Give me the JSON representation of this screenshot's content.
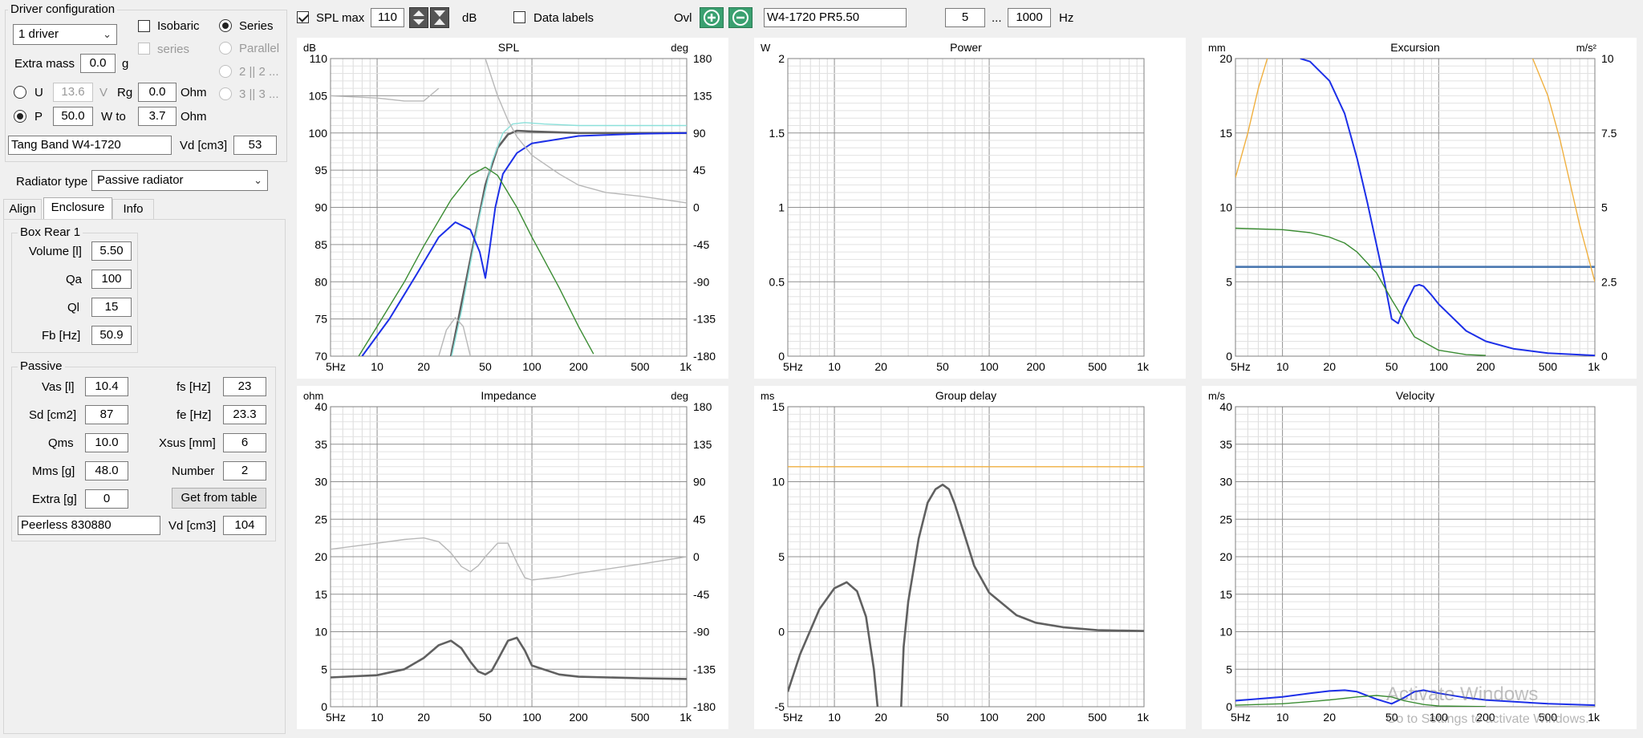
{
  "sidebar": {
    "driver_config_title": "Driver configuration",
    "driver_count": "1 driver",
    "isobaric": "Isobaric",
    "series": "Series",
    "series_sub": "series",
    "parallel": "Parallel",
    "par2": "2 || 2 ...",
    "par3": "3 || 3 ...",
    "extra_mass_label": "Extra mass",
    "extra_mass_value": "0.0",
    "extra_mass_unit": "g",
    "u_label": "U",
    "u_value": "13.6",
    "u_unit": "V",
    "rg_label": "Rg",
    "rg_value": "0.0",
    "rg_unit": "Ohm",
    "p_label": "P",
    "p_value": "50.0",
    "wto_label": "W to",
    "wto_value": "3.7",
    "wto_unit": "Ohm",
    "driver_name": "Tang Band W4-1720",
    "vd_label": "Vd [cm3]",
    "vd_value": "53",
    "radiator_type_label": "Radiator type",
    "radiator_type_value": "Passive radiator",
    "tabs": [
      "Align",
      "Enclosure",
      "Info"
    ],
    "box_title": "Box Rear 1",
    "volume_label": "Volume [l]",
    "volume_value": "5.50",
    "qa_label": "Qa",
    "qa_value": "100",
    "ql_label": "Ql",
    "ql_value": "15",
    "fb_label": "Fb [Hz]",
    "fb_value": "50.9",
    "passive_title": "Passive",
    "vas_label": "Vas [l]",
    "vas_value": "10.4",
    "fs_label": "fs [Hz]",
    "fs_value": "23",
    "sd_label": "Sd [cm2]",
    "sd_value": "87",
    "fe_label": "fe [Hz]",
    "fe_value": "23.3",
    "qms_label": "Qms",
    "qms_value": "10.0",
    "xsus_label": "Xsus [mm]",
    "xsus_value": "6",
    "mms_label": "Mms [g]",
    "mms_value": "48.0",
    "number_label": "Number",
    "number_value": "2",
    "extra_label": "Extra [g]",
    "extra_value": "0",
    "get_table": "Get from table",
    "pr_name": "Peerless 830880",
    "pr_vd_label": "Vd [cm3]",
    "pr_vd_value": "104"
  },
  "toolbar": {
    "spl_max_label": "SPL max",
    "spl_max_value": "110",
    "db_unit": "dB",
    "data_labels": "Data labels",
    "ovl_label": "Ovl",
    "overlay_name": "W4-1720 PR5.50",
    "freq_min": "5",
    "freq_sep": "...",
    "freq_max": "1000",
    "hz_unit": "Hz"
  },
  "colors": {
    "dark": "#606060",
    "blue": "#1c2fe8",
    "green": "#3a8c32",
    "grey": "#b8b8b8",
    "cyan": "#8ce0da",
    "orange": "#f0b040",
    "steel": "#4a78b0"
  },
  "xticks": [
    "5Hz",
    "10",
    "20",
    "50",
    "100",
    "200",
    "500",
    "1k"
  ],
  "charts": [
    {
      "id": "spl",
      "title": "SPL",
      "lunit": "dB",
      "runit": "deg",
      "ylim": [
        70,
        110
      ],
      "lt": [
        "110",
        "105",
        "100",
        "95",
        "90",
        "85",
        "80",
        "75",
        "70"
      ],
      "rt": [
        "180",
        "135",
        "90",
        "45",
        "0",
        "-45",
        "-90",
        "-135",
        "-180"
      ]
    },
    {
      "id": "power",
      "title": "Power",
      "lunit": "W",
      "runit": "",
      "ylim": [
        0,
        2
      ],
      "lt": [
        "2",
        "1.5",
        "1",
        "0.5",
        "0"
      ],
      "rt": []
    },
    {
      "id": "excursion",
      "title": "Excursion",
      "lunit": "mm",
      "runit": "m/s²",
      "ylim": [
        0,
        20
      ],
      "lt": [
        "20",
        "15",
        "10",
        "5",
        "0"
      ],
      "rt": [
        "10",
        "7.5",
        "5",
        "2.5",
        "0"
      ]
    },
    {
      "id": "impedance",
      "title": "Impedance",
      "lunit": "ohm",
      "runit": "deg",
      "ylim": [
        0,
        40
      ],
      "lt": [
        "40",
        "35",
        "30",
        "25",
        "20",
        "15",
        "10",
        "5",
        "0"
      ],
      "rt": [
        "180",
        "135",
        "90",
        "45",
        "0",
        "-45",
        "-90",
        "-135",
        "-180"
      ]
    },
    {
      "id": "group_delay",
      "title": "Group delay",
      "lunit": "ms",
      "runit": "",
      "ylim": [
        -5,
        15
      ],
      "lt": [
        "15",
        "10",
        "5",
        "0",
        "-5"
      ],
      "rt": []
    },
    {
      "id": "velocity",
      "title": "Velocity",
      "lunit": "m/s",
      "runit": "",
      "ylim": [
        0,
        40
      ],
      "lt": [
        "40",
        "35",
        "30",
        "25",
        "20",
        "15",
        "10",
        "5",
        "0"
      ],
      "rt": []
    }
  ],
  "chart_data": [
    {
      "type": "line",
      "title": "SPL",
      "xlabel": "",
      "ylabel": "dB",
      "ylim": [
        70,
        110
      ],
      "xlim": [
        5,
        1000
      ],
      "xscale": "log",
      "series": [
        {
          "color": "#606060",
          "x": [
            20,
            30,
            40,
            50,
            60,
            70,
            80,
            100,
            200,
            500,
            1000
          ],
          "y": [
            55,
            70,
            83,
            93,
            98,
            99.8,
            100.3,
            100.2,
            100,
            100,
            100
          ]
        },
        {
          "color": "#8ce0da",
          "x": [
            25,
            35,
            45,
            55,
            65,
            75,
            90,
            120,
            200,
            500,
            1000
          ],
          "y": [
            62,
            76,
            88,
            96,
            100,
            101.2,
            101.4,
            101.2,
            101,
            101,
            101
          ]
        },
        {
          "color": "#1c2fe8",
          "x": [
            8,
            12,
            18,
            25,
            32,
            40,
            46,
            50,
            53,
            58,
            65,
            80,
            100,
            200,
            500,
            1000
          ],
          "y": [
            70,
            75,
            81,
            86,
            88,
            87,
            84,
            80.5,
            84,
            90,
            94.5,
            97.3,
            98.6,
            99.6,
            99.9,
            100
          ]
        },
        {
          "color": "#3a8c32",
          "x": [
            7.6,
            10,
            15,
            20,
            30,
            40,
            50,
            60,
            80,
            100,
            150,
            200,
            250
          ],
          "y": [
            70,
            74,
            80,
            84.8,
            91,
            94.3,
            95.4,
            94.3,
            90,
            86,
            79.2,
            74,
            70.3
          ]
        },
        {
          "color": "#b8b8b8",
          "x": [
            5,
            10,
            15,
            20,
            25
          ],
          "y": [
            105,
            104.7,
            104.3,
            104.3,
            106
          ]
        },
        {
          "color": "#b8b8b8",
          "x": [
            50,
            60,
            70,
            80,
            100,
            150,
            200,
            300,
            500,
            1000
          ],
          "y": [
            110,
            105,
            101.7,
            99.5,
            97,
            94.5,
            93,
            92,
            91.5,
            90.6
          ]
        },
        {
          "color": "#b8b8b8",
          "x": [
            25,
            28,
            32,
            36,
            40
          ],
          "y": [
            70,
            73.5,
            75.2,
            74,
            70
          ]
        }
      ]
    },
    {
      "type": "line",
      "title": "Power",
      "xlabel": "",
      "ylabel": "W",
      "ylim": [
        0,
        2
      ],
      "xlim": [
        5,
        1000
      ],
      "xscale": "log",
      "series": []
    },
    {
      "type": "line",
      "title": "Excursion",
      "xlabel": "",
      "ylabel": "mm",
      "ylim": [
        0,
        20
      ],
      "xlim": [
        5,
        1000
      ],
      "xscale": "log",
      "series": [
        {
          "color": "#4a78b0",
          "x": [
            5,
            1000
          ],
          "y": [
            6,
            6
          ]
        },
        {
          "color": "#1c2fe8",
          "x": [
            13,
            15,
            20,
            25,
            30,
            35,
            40,
            45,
            50,
            55,
            60,
            70,
            75,
            80,
            90,
            100,
            150,
            200,
            300,
            500,
            1000
          ],
          "y": [
            20,
            19.8,
            18.5,
            16.3,
            13.3,
            10.3,
            7.5,
            5,
            2.5,
            2.2,
            3.3,
            4.7,
            4.8,
            4.7,
            4.1,
            3.5,
            1.7,
            1.0,
            0.5,
            0.2,
            0.05
          ]
        },
        {
          "color": "#3a8c32",
          "x": [
            5,
            10,
            15,
            20,
            25,
            30,
            40,
            50,
            70,
            100,
            150,
            200
          ],
          "y": [
            8.6,
            8.5,
            8.3,
            8,
            7.6,
            7,
            5.6,
            3.8,
            1.3,
            0.4,
            0.1,
            0.05
          ]
        },
        {
          "color": "#f0b040",
          "x": [
            5,
            6,
            7,
            8
          ],
          "y": [
            12,
            15,
            18,
            20
          ]
        },
        {
          "color": "#f0b040",
          "x": [
            400,
            500,
            600,
            800,
            1000
          ],
          "y": [
            20,
            17.5,
            14.5,
            8.8,
            5
          ]
        }
      ]
    },
    {
      "type": "line",
      "title": "Impedance",
      "xlabel": "",
      "ylabel": "ohm",
      "ylim": [
        0,
        40
      ],
      "xlim": [
        5,
        1000
      ],
      "xscale": "log",
      "series": [
        {
          "color": "#606060",
          "x": [
            5,
            10,
            15,
            20,
            25,
            30,
            35,
            40,
            45,
            50,
            55,
            60,
            70,
            80,
            90,
            100,
            150,
            200,
            500,
            1000
          ],
          "y": [
            3.9,
            4.2,
            5,
            6.5,
            8.2,
            8.8,
            7.8,
            6,
            4.7,
            4.3,
            4.8,
            6.2,
            8.8,
            9.2,
            7.5,
            5.5,
            4.3,
            4,
            3.8,
            3.7
          ]
        },
        {
          "color": "#b8b8b8",
          "x": [
            5,
            10,
            15,
            20,
            25,
            30,
            35,
            40,
            45,
            50,
            60,
            70,
            80,
            90,
            100,
            150,
            200,
            500,
            1000
          ],
          "y": [
            21,
            21.8,
            22.3,
            22.5,
            22,
            20.5,
            18.7,
            18,
            18.8,
            20,
            21.8,
            21.8,
            19.2,
            17.2,
            16.9,
            17.3,
            17.8,
            19,
            20
          ]
        }
      ]
    },
    {
      "type": "line",
      "title": "Group delay",
      "xlabel": "",
      "ylabel": "ms",
      "ylim": [
        -5,
        15
      ],
      "xlim": [
        5,
        1000
      ],
      "xscale": "log",
      "series": [
        {
          "color": "#f0b040",
          "x": [
            5,
            1000
          ],
          "y": [
            11,
            11
          ]
        },
        {
          "color": "#606060",
          "x": [
            5,
            6,
            8,
            10,
            12,
            14,
            16,
            18,
            19
          ],
          "y": [
            -4,
            -1.5,
            1.5,
            2.9,
            3.3,
            2.7,
            1,
            -2.5,
            -5
          ]
        },
        {
          "color": "#606060",
          "x": [
            27,
            28,
            30,
            35,
            40,
            45,
            50,
            55,
            60,
            70,
            80,
            100,
            150,
            200,
            300,
            500,
            1000
          ],
          "y": [
            -5,
            -1,
            2,
            6.2,
            8.6,
            9.5,
            9.8,
            9.5,
            8.5,
            6.3,
            4.4,
            2.6,
            1.1,
            0.6,
            0.3,
            0.1,
            0.05
          ]
        }
      ]
    },
    {
      "type": "line",
      "title": "Velocity",
      "xlabel": "",
      "ylabel": "m/s",
      "ylim": [
        0,
        40
      ],
      "xlim": [
        5,
        1000
      ],
      "xscale": "log",
      "series": [
        {
          "color": "#1c2fe8",
          "x": [
            5,
            10,
            15,
            20,
            25,
            30,
            40,
            50,
            60,
            70,
            80,
            100,
            150,
            200,
            500,
            1000
          ],
          "y": [
            0.8,
            1.3,
            1.8,
            2.1,
            2.2,
            2,
            1,
            0.4,
            1.2,
            2,
            2.2,
            1.8,
            1.2,
            0.9,
            0.4,
            0.2
          ]
        },
        {
          "color": "#3a8c32",
          "x": [
            5,
            10,
            20,
            30,
            40,
            50,
            60,
            80,
            100,
            200
          ],
          "y": [
            0.2,
            0.4,
            0.9,
            1.3,
            1.5,
            1.3,
            0.8,
            0.3,
            0.1,
            0.02
          ]
        }
      ]
    }
  ],
  "watermark": {
    "line1": "Activate Windows",
    "line2": "Go to Settings to activate Windows."
  }
}
